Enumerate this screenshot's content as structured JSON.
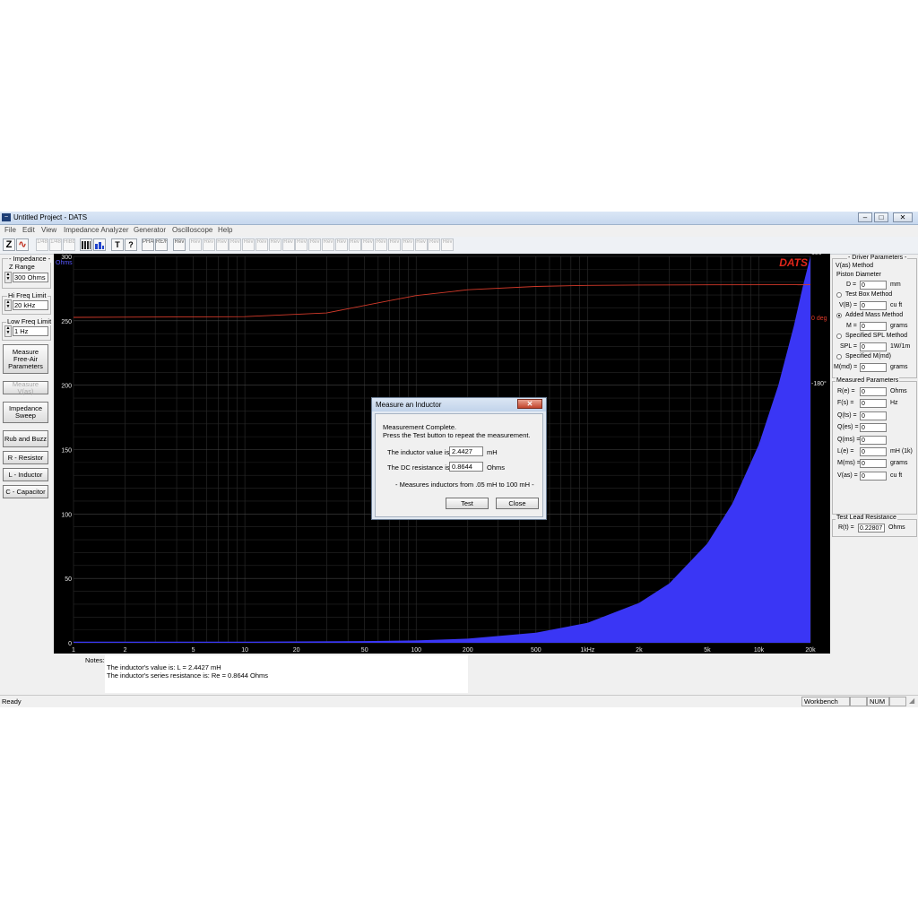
{
  "window": {
    "title": "Untitled Project - DATS",
    "min": "–",
    "max": "□",
    "close": "✕"
  },
  "menu": [
    "File",
    "Edit",
    "View",
    "Impedance Analyzer",
    "Generator",
    "Oscilloscope",
    "Help"
  ],
  "toolbar": {
    "z_label": "Z",
    "sine_label": "∿",
    "speaker_label": "♪",
    "t_label": "T",
    "small_labels": [
      "1/48",
      "1/48",
      "HiBb",
      "OB",
      "PHA",
      "RE/FR",
      "Rev"
    ]
  },
  "left": {
    "impedance_label": "- Impedance -",
    "z_range_label": "Z Range",
    "z_range_value": "300 Ohms",
    "hi_freq_label": "Hi Freq Limit",
    "hi_freq_value": "20 kHz",
    "low_freq_label": "Low Freq Limit",
    "low_freq_value": "1 Hz",
    "buttons": [
      "Measure Free-Air Parameters",
      "Measure V(as)",
      "Impedance Sweep",
      "Rub and Buzz",
      "R - Resistor",
      "L - Inductor",
      "C - Capacitor"
    ]
  },
  "chart_data": {
    "type": "area",
    "title": "",
    "logo": "DATS",
    "y_unit_label": "Ohms",
    "x_scale": "log",
    "xlim": [
      1,
      20000
    ],
    "ylim": [
      0,
      300
    ],
    "x_ticks": [
      1,
      2,
      5,
      10,
      20,
      50,
      100,
      200,
      500,
      1000,
      2000,
      5000,
      10000,
      20000
    ],
    "x_tick_labels": [
      "1",
      "2",
      "5",
      "10",
      "20",
      "50",
      "100",
      "200",
      "500",
      "1kHz",
      "2k",
      "5k",
      "10k",
      "20k"
    ],
    "y_ticks": [
      0,
      50,
      100,
      150,
      200,
      250,
      300
    ],
    "y_tick_labels": [
      "0",
      "50",
      "100",
      "150",
      "200",
      "250",
      "300"
    ],
    "phase_ticks": [
      180,
      0,
      -180
    ],
    "phase_tick_labels": [
      "180°",
      "0 deg",
      "-180°"
    ],
    "grid": true,
    "series": [
      {
        "kind": "impedance_ohms",
        "color": "#3a36f5",
        "x": [
          1,
          10,
          50,
          100,
          200,
          500,
          1000,
          2000,
          3000,
          5000,
          7000,
          10000,
          13000,
          16000,
          18000,
          20000
        ],
        "values": [
          0.9,
          0.9,
          1.3,
          1.8,
          3.2,
          7.8,
          15.5,
          31,
          46,
          77,
          108,
          154,
          200,
          246,
          276,
          300
        ]
      },
      {
        "kind": "phase_deg",
        "color": "#d23a2a",
        "x": [
          1,
          10,
          30,
          60,
          100,
          200,
          500,
          1000,
          2000,
          5000,
          20000
        ],
        "values": [
          0,
          2,
          12,
          40,
          60,
          76,
          85,
          88,
          89,
          89.5,
          89.8
        ]
      }
    ]
  },
  "right": {
    "driver_params_label": "- Driver Parameters -",
    "vas_method_label": "V(as) Method",
    "piston_label": "Piston Diameter",
    "d_label": "D =",
    "d_value": "0",
    "d_unit": "mm",
    "test_box_label": "Test Box Method",
    "vb_label": "V(B) =",
    "vb_value": "0",
    "vb_unit": "cu ft",
    "added_mass_label": "Added Mass Method",
    "m_label": "M =",
    "m_value": "0",
    "m_unit": "grams",
    "spl_method_label": "Specified SPL Method",
    "spl_label": "SPL =",
    "spl_value": "0",
    "spl_unit": "1W/1m",
    "mmd_method_label": "Specified M(md)",
    "mmd_label": "M(md) =",
    "mmd_value": "0",
    "mmd_unit": "grams",
    "measured_label": "Measured Parameters",
    "measured": [
      {
        "label": "R(e) =",
        "value": "0",
        "unit": "Ohms"
      },
      {
        "label": "F(s) =",
        "value": "0",
        "unit": "Hz"
      },
      {
        "label": "Q(ts) =",
        "value": "0",
        "unit": ""
      },
      {
        "label": "Q(es) =",
        "value": "0",
        "unit": ""
      },
      {
        "label": "Q(ms) =",
        "value": "0",
        "unit": ""
      },
      {
        "label": "L(e) =",
        "value": "0",
        "unit": "mH (1k)"
      },
      {
        "label": "M(ms) =",
        "value": "0",
        "unit": "grams"
      },
      {
        "label": "V(as) =",
        "value": "0",
        "unit": "cu ft"
      }
    ],
    "test_lead_label": "Test Lead Resistance",
    "rt_label": "R(t) =",
    "rt_value": "0.22807",
    "rt_unit": "Ohms"
  },
  "notes": {
    "label": "Notes:",
    "line1": "The inductor's value is:   L = 2.4427 mH",
    "line2": "The inductor's series resistance is:   Re = 0.8644 Ohms"
  },
  "status": {
    "ready": "Ready",
    "workbench": "Workbench",
    "num": "NUM"
  },
  "dialog": {
    "title": "Measure an Inductor",
    "line1": "Measurement Complete.",
    "line2": "Press the Test button to repeat the measurement.",
    "inductor_label": "The inductor value is:",
    "inductor_value": "2.4427",
    "inductor_unit": "mH",
    "dcr_label": "The DC resistance is:",
    "dcr_value": "0.8644",
    "dcr_unit": "Ohms",
    "range_note": "- Measures inductors from .05 mH to 100 mH -",
    "test_button": "Test",
    "close_button": "Close"
  }
}
